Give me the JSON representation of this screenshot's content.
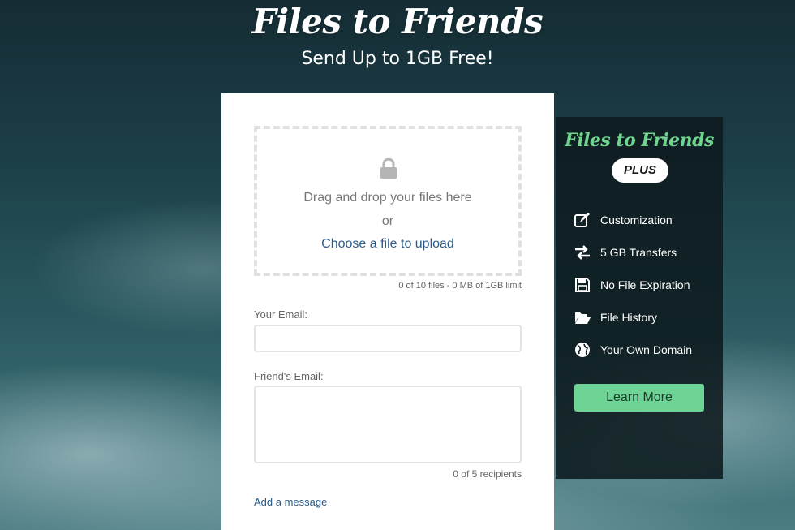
{
  "header": {
    "title": "Files to Friends",
    "subtitle": "Send Up to 1GB Free!"
  },
  "upload": {
    "icon": "lock-icon",
    "drag_text": "Drag and drop your files here",
    "or_text": "or",
    "choose_link": "Choose a file to upload",
    "limit_text": "0 of 10 files - 0 MB of 1GB limit"
  },
  "form": {
    "your_email_label": "Your Email:",
    "your_email_value": "",
    "friends_email_label": "Friend's Email:",
    "friends_email_value": "",
    "recipients_text": "0 of 5 recipients",
    "add_message_link": "Add a message"
  },
  "plus_panel": {
    "title": "Files to Friends",
    "badge": "PLUS",
    "features": [
      {
        "icon": "edit-icon",
        "label": "Customization"
      },
      {
        "icon": "transfer-arrows-icon",
        "label": "5 GB Transfers"
      },
      {
        "icon": "floppy-disk-icon",
        "label": "No File Expiration"
      },
      {
        "icon": "folder-open-icon",
        "label": "File History"
      },
      {
        "icon": "globe-icon",
        "label": "Your Own Domain"
      }
    ],
    "learn_more_label": "Learn More"
  },
  "colors": {
    "accent_green": "#6dd496",
    "link_blue": "#2b5a8a",
    "panel_bg": "#0e1a1e"
  }
}
